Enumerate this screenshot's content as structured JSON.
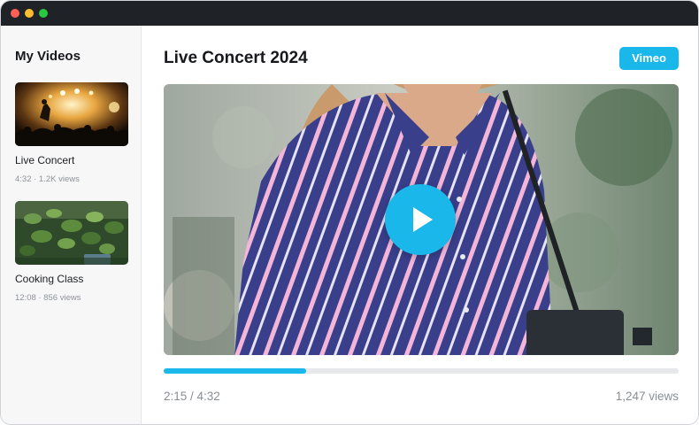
{
  "window": {
    "controls": [
      "close",
      "minimize",
      "maximize"
    ]
  },
  "sidebar": {
    "title": "My Videos",
    "items": [
      {
        "title": "Live Concert",
        "meta": "4:32 · 1.2K views",
        "thumbnail": "concert-stage-thumbnail"
      },
      {
        "title": "Cooking Class",
        "meta": "12:08 · 856 views",
        "thumbnail": "herbs-plant-thumbnail"
      }
    ]
  },
  "main": {
    "title": "Live Concert 2024",
    "brand_badge": "Vimeo",
    "player": {
      "poster": "performer-striped-shirt-microphone-stand",
      "play_icon": "play-icon",
      "progress": 0.276,
      "time": "2:15 / 4:32",
      "views": "1,247 views"
    }
  },
  "colors": {
    "accent": "#1ab7ea",
    "titlebar": "#1f2226",
    "sidebar_bg": "#f7f7f8"
  }
}
